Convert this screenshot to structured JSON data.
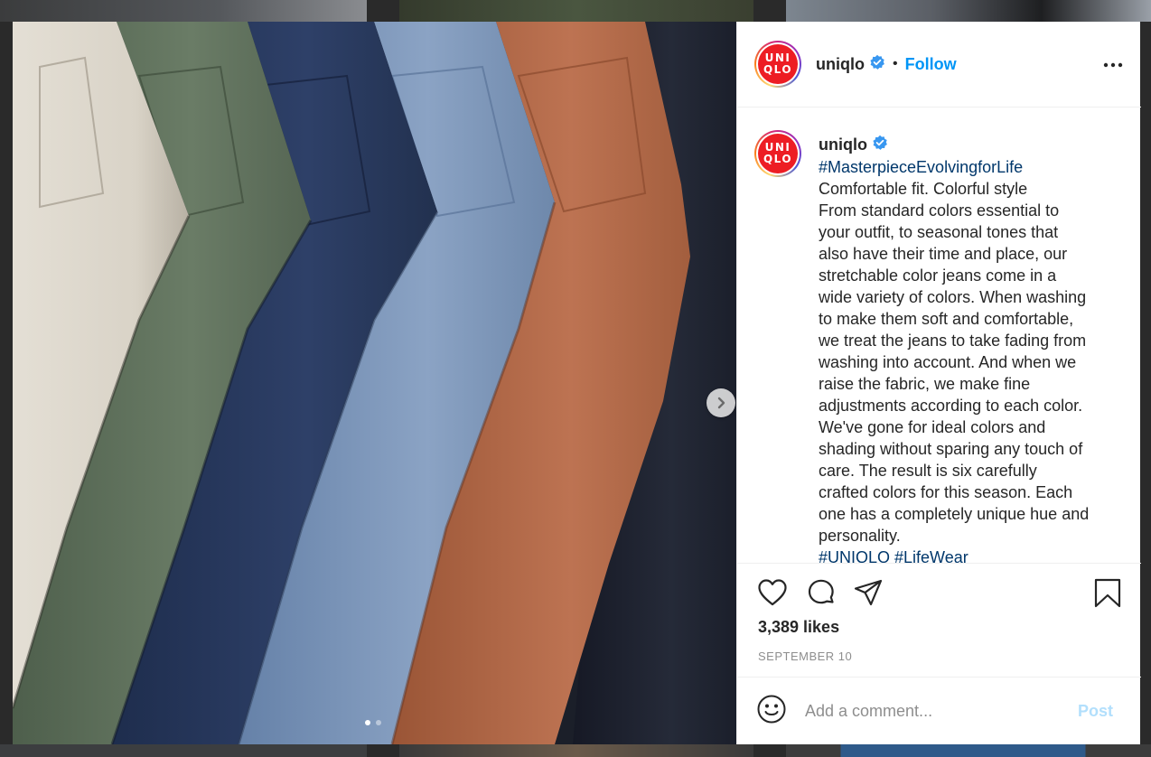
{
  "post": {
    "image_alt": "Six pairs of colored jeans laid side by side",
    "carousel": {
      "current": 1,
      "total": 2
    }
  },
  "header": {
    "username": "uniqlo",
    "separator": "•",
    "follow_label": "Follow",
    "logo_line1": "UNI",
    "logo_line2": "QLO"
  },
  "caption": {
    "username": "uniqlo",
    "hashtag": "#MasterpieceEvolvingforLife",
    "lines": [
      "Comfortable fit. Colorful style",
      "From standard colors essential to",
      "your outfit, to seasonal tones that",
      "also have their time and place, our",
      "stretchable color jeans come in a",
      "wide variety of colors. When washing",
      "to make them soft and comfortable,",
      "we treat the jeans to take fading from",
      "washing into account. And when we",
      "raise the fabric, we make fine",
      "adjustments according to each color.",
      "We've gone for ideal colors and",
      "shading without sparing any touch of",
      "care. The result is six carefully",
      "crafted colors for this season. Each",
      "one has a completely unique hue and",
      "personality."
    ],
    "hashtags_bottom": "#UNIQLO #LifeWear"
  },
  "actions": {
    "likes": "3,389 likes",
    "date": "SEPTEMBER 10"
  },
  "comment": {
    "placeholder": "Add a comment...",
    "post_label": "Post"
  },
  "colors": {
    "follow": "#0095f6",
    "hashtag": "#00376b",
    "post_disabled": "#b2dffc",
    "logo_red": "#ed1d24",
    "verified": "#3897f0"
  },
  "icons": [
    "verified-badge-icon",
    "more-options-icon",
    "heart-icon",
    "comment-icon",
    "share-icon",
    "bookmark-icon",
    "emoji-icon",
    "chevron-right-icon"
  ]
}
